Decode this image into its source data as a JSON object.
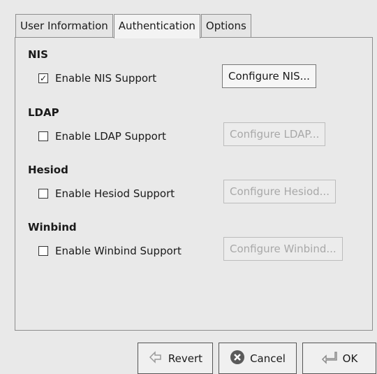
{
  "tabs": [
    "User Information",
    "Authentication",
    "Options"
  ],
  "sections": [
    {
      "title": "NIS",
      "checkbox_label": "Enable NIS Support",
      "checkbox_checked": true,
      "button_label": "Configure NIS...",
      "button_enabled": true
    },
    {
      "title": "LDAP",
      "checkbox_label": "Enable LDAP Support",
      "checkbox_checked": false,
      "button_label": "Configure LDAP...",
      "button_enabled": false
    },
    {
      "title": "Hesiod",
      "checkbox_label": "Enable Hesiod Support",
      "checkbox_checked": false,
      "button_label": "Configure Hesiod...",
      "button_enabled": false
    },
    {
      "title": "Winbind",
      "checkbox_label": "Enable Winbind Support",
      "checkbox_checked": false,
      "button_label": "Configure Winbind...",
      "button_enabled": false
    }
  ],
  "buttons": {
    "revert": "Revert",
    "cancel": "Cancel",
    "ok": "OK"
  },
  "icons": {
    "revert": "revert-icon",
    "cancel": "cancel-icon",
    "ok": "ok-icon"
  },
  "colors": {
    "cancel_icon": "#5a5a5a",
    "disabled_text": "#a8a8a8"
  }
}
